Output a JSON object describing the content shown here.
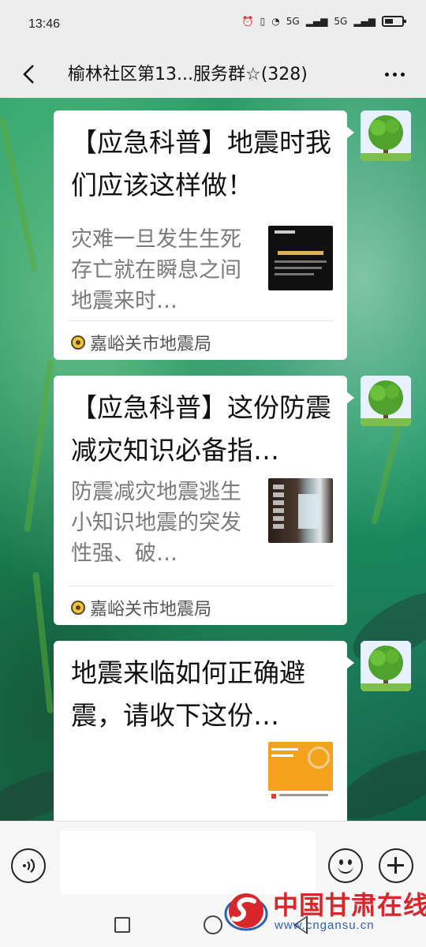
{
  "status_bar": {
    "time": "13:46",
    "icons": [
      "alarm-icon",
      "vibrate-icon",
      "wifi-icon",
      "signal-5g-icon",
      "signal-5g-icon",
      "battery-icon"
    ],
    "sim1_label": "5G",
    "sim2_label": "5G"
  },
  "header": {
    "title": "榆林社区第13...服务群☆(328)",
    "back_icon": "chevron-left-icon",
    "more_icon": "more-horizontal-icon"
  },
  "messages": [
    {
      "title": "【应急科普】地震时我们应该这样做！",
      "description": "灾难一旦发生生死存亡就在瞬息之间地震来时…",
      "source": "嘉峪关市地震局",
      "thumbnail": "dark-poster-thumbnail"
    },
    {
      "title": "【应急科普】这份防震减灾知识必备指…",
      "description": "防震减灾地震逃生小知识地震的突发性强、破…",
      "source": "嘉峪关市地震局",
      "thumbnail": "window-photo-thumbnail"
    },
    {
      "title": "地震来临如何正确避震，请收下这份…",
      "description": "",
      "source": "",
      "thumbnail": "orange-poster-thumbnail"
    }
  ],
  "input_bar": {
    "voice_icon": "voice-icon",
    "emoji_icon": "emoji-icon",
    "plus_icon": "plus-icon",
    "placeholder": ""
  },
  "nav_bar": {
    "recent_icon": "square-icon",
    "home_icon": "circle-icon",
    "back_icon": "triangle-back-icon"
  },
  "watermark": {
    "name": "中国甘肃在线",
    "url": "www.cngansu.cn"
  },
  "colors": {
    "accent_red": "#d8262a",
    "watermark_blue": "#2f5fb4",
    "chat_green": "#1f8d5c"
  }
}
